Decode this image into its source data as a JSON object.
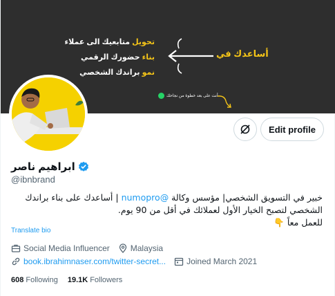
{
  "banner": {
    "helps_label": "أساعدك في",
    "lines": [
      {
        "highlight": "تحويل",
        "rest": " متابعيك الى عملاء"
      },
      {
        "highlight": "بناء",
        "rest": " حضورك الرقمي"
      },
      {
        "highlight": "نمو",
        "rest": " براندك الشخصي"
      }
    ],
    "tagline": "أنت على بعد خطوة من نجاحك"
  },
  "profile": {
    "display_name": "ابراهيم ناصر",
    "handle": "@ibnbrand",
    "edit_label": "Edit profile",
    "bio": {
      "part1": "خبير في التسويق الشخصي| مؤسس وكالة ",
      "mention": "@numopro",
      "part2": " | أساعدك على بناء براندك الشخصي لتصبح الخيار الأول لعملائك في أقل من 90 يوم.",
      "part3": "للعمل معاً 👇"
    },
    "translate_label": "Translate bio",
    "category": "Social Media Influencer",
    "location": "Malaysia",
    "website": "book.ibrahimnaser.com/twitter-secret...",
    "joined": "Joined March 2021",
    "following_count": "608",
    "following_label": "Following",
    "followers_count": "19.1K",
    "followers_label": "Followers"
  },
  "colors": {
    "accent": "#1d9bf0",
    "banner_bg": "#2e2e2e",
    "banner_highlight": "#f5c518"
  }
}
